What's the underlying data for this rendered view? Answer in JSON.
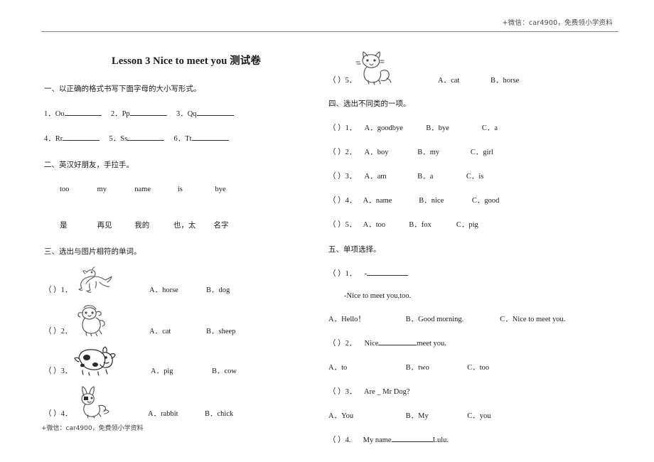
{
  "watermark": {
    "header": "+微信：car4900，免费领小学资料",
    "footer": "+微信：car4900，免费领小学资料"
  },
  "document": {
    "title": "Lesson 3 Nice to meet you 测试卷"
  },
  "sections": {
    "one": {
      "heading": "一、以正确的格式书写下面字母的大小写形式。",
      "row1": [
        {
          "num": "1．",
          "letter": "Oo"
        },
        {
          "num": "2．",
          "letter": "Pp"
        },
        {
          "num": "3．",
          "letter": "Qq"
        }
      ],
      "row2": [
        {
          "num": "4．",
          "letter": "Rr"
        },
        {
          "num": "5．",
          "letter": "Ss"
        },
        {
          "num": "6．",
          "letter": "Tt"
        }
      ]
    },
    "two": {
      "heading": "二、英汉好朋友，手拉手。",
      "english": [
        "too",
        "my",
        "name",
        "is",
        "bye"
      ],
      "chinese": [
        "是",
        "再见",
        "我的",
        "也，太",
        "名字"
      ]
    },
    "three": {
      "heading": "三、选出与图片相符的单词。",
      "items": [
        {
          "paren": "（    ）1．",
          "picture": "horse-picture",
          "a": "A．horse",
          "b": "B．dog"
        },
        {
          "paren": "（    ）2．",
          "picture": "sheep-picture",
          "a": "A．cat",
          "b": "B．sheep"
        },
        {
          "paren": "（    ）3．",
          "picture": "cow-picture",
          "a": "A．pig",
          "b": "B．cow"
        },
        {
          "paren": "（    ）4．",
          "picture": "rabbit-picture",
          "a": "A．rabbit",
          "b": "B．chick"
        },
        {
          "paren": "（    ）5．",
          "picture": "cat-picture",
          "a": "A．cat",
          "b": "B．horse"
        }
      ]
    },
    "four": {
      "heading": "四、选出不同类的一项。",
      "items": [
        {
          "paren": "（    ）1．",
          "a": "A．goodbye",
          "b": "B．bye",
          "c": "C．a"
        },
        {
          "paren": "（    ）2．",
          "a": "A．boy",
          "b": "B．my",
          "c": "C．girl"
        },
        {
          "paren": "（    ）3．",
          "a": "A．am",
          "b": "B．a",
          "c": "C．is"
        },
        {
          "paren": "（    ）4．",
          "a": "A．name",
          "b": "B．nice",
          "c": "C．good"
        },
        {
          "paren": "（    ）5．",
          "a": "A．too",
          "b": "B．fox",
          "c": "C．pig"
        }
      ]
    },
    "five": {
      "heading": "五、单项选择。",
      "q1": {
        "stem_paren": "（    ）1．",
        "stem_dash": "-",
        "reply": "-Nice to meet you,too.",
        "a": "A．Hello！",
        "b": "B．Good morning.",
        "c": "C．Nice to meet you."
      },
      "q2": {
        "stem_paren": "（    ）2．",
        "stem_before": "Nice",
        "stem_after": "meet you.",
        "a": "A．to",
        "b": "B．two",
        "c": "C．too"
      },
      "q3": {
        "stem_paren": "（    ）3．",
        "stem": "Are _ Mr Dog?",
        "a": "A．You",
        "b": "B．My",
        "c": "C．you"
      },
      "q4": {
        "stem_paren": "（    ）4.",
        "stem_before": "My name",
        "stem_after": "Lulu."
      }
    }
  }
}
